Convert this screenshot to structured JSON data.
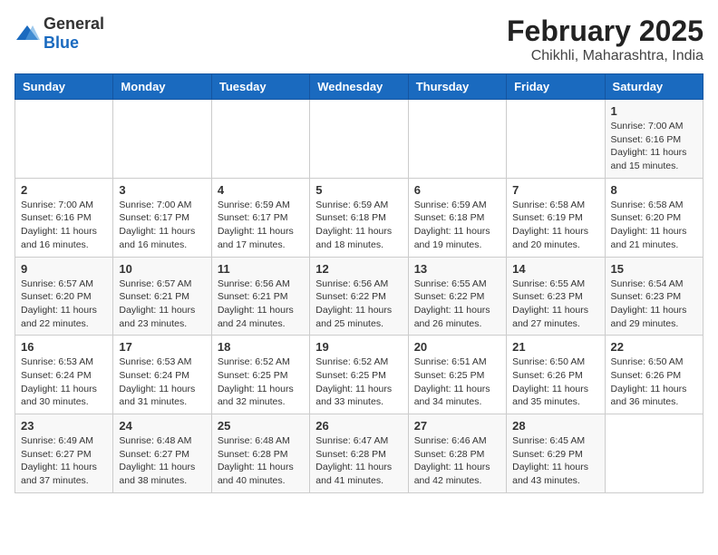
{
  "header": {
    "logo_general": "General",
    "logo_blue": "Blue",
    "title": "February 2025",
    "subtitle": "Chikhli, Maharashtra, India"
  },
  "weekdays": [
    "Sunday",
    "Monday",
    "Tuesday",
    "Wednesday",
    "Thursday",
    "Friday",
    "Saturday"
  ],
  "weeks": [
    [
      {
        "day": "",
        "info": ""
      },
      {
        "day": "",
        "info": ""
      },
      {
        "day": "",
        "info": ""
      },
      {
        "day": "",
        "info": ""
      },
      {
        "day": "",
        "info": ""
      },
      {
        "day": "",
        "info": ""
      },
      {
        "day": "1",
        "info": "Sunrise: 7:00 AM\nSunset: 6:16 PM\nDaylight: 11 hours\nand 15 minutes."
      }
    ],
    [
      {
        "day": "2",
        "info": "Sunrise: 7:00 AM\nSunset: 6:16 PM\nDaylight: 11 hours\nand 16 minutes."
      },
      {
        "day": "3",
        "info": "Sunrise: 7:00 AM\nSunset: 6:17 PM\nDaylight: 11 hours\nand 16 minutes."
      },
      {
        "day": "4",
        "info": "Sunrise: 6:59 AM\nSunset: 6:17 PM\nDaylight: 11 hours\nand 17 minutes."
      },
      {
        "day": "5",
        "info": "Sunrise: 6:59 AM\nSunset: 6:18 PM\nDaylight: 11 hours\nand 18 minutes."
      },
      {
        "day": "6",
        "info": "Sunrise: 6:59 AM\nSunset: 6:18 PM\nDaylight: 11 hours\nand 19 minutes."
      },
      {
        "day": "7",
        "info": "Sunrise: 6:58 AM\nSunset: 6:19 PM\nDaylight: 11 hours\nand 20 minutes."
      },
      {
        "day": "8",
        "info": "Sunrise: 6:58 AM\nSunset: 6:20 PM\nDaylight: 11 hours\nand 21 minutes."
      }
    ],
    [
      {
        "day": "9",
        "info": "Sunrise: 6:57 AM\nSunset: 6:20 PM\nDaylight: 11 hours\nand 22 minutes."
      },
      {
        "day": "10",
        "info": "Sunrise: 6:57 AM\nSunset: 6:21 PM\nDaylight: 11 hours\nand 23 minutes."
      },
      {
        "day": "11",
        "info": "Sunrise: 6:56 AM\nSunset: 6:21 PM\nDaylight: 11 hours\nand 24 minutes."
      },
      {
        "day": "12",
        "info": "Sunrise: 6:56 AM\nSunset: 6:22 PM\nDaylight: 11 hours\nand 25 minutes."
      },
      {
        "day": "13",
        "info": "Sunrise: 6:55 AM\nSunset: 6:22 PM\nDaylight: 11 hours\nand 26 minutes."
      },
      {
        "day": "14",
        "info": "Sunrise: 6:55 AM\nSunset: 6:23 PM\nDaylight: 11 hours\nand 27 minutes."
      },
      {
        "day": "15",
        "info": "Sunrise: 6:54 AM\nSunset: 6:23 PM\nDaylight: 11 hours\nand 29 minutes."
      }
    ],
    [
      {
        "day": "16",
        "info": "Sunrise: 6:53 AM\nSunset: 6:24 PM\nDaylight: 11 hours\nand 30 minutes."
      },
      {
        "day": "17",
        "info": "Sunrise: 6:53 AM\nSunset: 6:24 PM\nDaylight: 11 hours\nand 31 minutes."
      },
      {
        "day": "18",
        "info": "Sunrise: 6:52 AM\nSunset: 6:25 PM\nDaylight: 11 hours\nand 32 minutes."
      },
      {
        "day": "19",
        "info": "Sunrise: 6:52 AM\nSunset: 6:25 PM\nDaylight: 11 hours\nand 33 minutes."
      },
      {
        "day": "20",
        "info": "Sunrise: 6:51 AM\nSunset: 6:25 PM\nDaylight: 11 hours\nand 34 minutes."
      },
      {
        "day": "21",
        "info": "Sunrise: 6:50 AM\nSunset: 6:26 PM\nDaylight: 11 hours\nand 35 minutes."
      },
      {
        "day": "22",
        "info": "Sunrise: 6:50 AM\nSunset: 6:26 PM\nDaylight: 11 hours\nand 36 minutes."
      }
    ],
    [
      {
        "day": "23",
        "info": "Sunrise: 6:49 AM\nSunset: 6:27 PM\nDaylight: 11 hours\nand 37 minutes."
      },
      {
        "day": "24",
        "info": "Sunrise: 6:48 AM\nSunset: 6:27 PM\nDaylight: 11 hours\nand 38 minutes."
      },
      {
        "day": "25",
        "info": "Sunrise: 6:48 AM\nSunset: 6:28 PM\nDaylight: 11 hours\nand 40 minutes."
      },
      {
        "day": "26",
        "info": "Sunrise: 6:47 AM\nSunset: 6:28 PM\nDaylight: 11 hours\nand 41 minutes."
      },
      {
        "day": "27",
        "info": "Sunrise: 6:46 AM\nSunset: 6:28 PM\nDaylight: 11 hours\nand 42 minutes."
      },
      {
        "day": "28",
        "info": "Sunrise: 6:45 AM\nSunset: 6:29 PM\nDaylight: 11 hours\nand 43 minutes."
      },
      {
        "day": "",
        "info": ""
      }
    ]
  ]
}
